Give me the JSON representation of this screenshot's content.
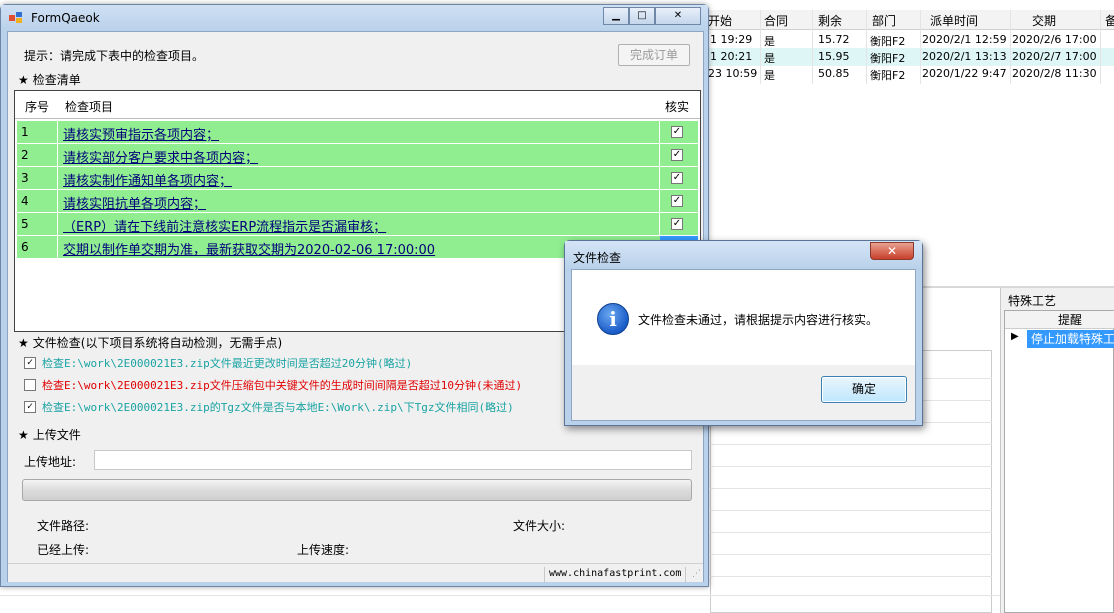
{
  "background": {
    "headers": [
      "开始",
      "合同",
      "剩余",
      "部门",
      "派单时间",
      "交期",
      "备"
    ],
    "rows": [
      {
        "start": "1 19:29",
        "contract": "是",
        "remaining": "15.72",
        "dept": "衡阳F2",
        "dispatch": "2020/2/1 12:59",
        "due": "2020/2/6 17:00"
      },
      {
        "start": "1 20:21",
        "contract": "是",
        "remaining": "15.95",
        "dept": "衡阳F2",
        "dispatch": "2020/2/1 13:13",
        "due": "2020/2/7 17:00"
      },
      {
        "start": "23 10:59",
        "contract": "是",
        "remaining": "50.85",
        "dept": "衡阳F2",
        "dispatch": "2020/1/22 9:47",
        "due": "2020/2/8 11:30"
      }
    ],
    "special_process": {
      "title": "特殊工艺",
      "column": "提醒",
      "cell": "停止加载特殊工"
    }
  },
  "form": {
    "title": "FormQaeok",
    "buttons": {
      "minimize": "▁",
      "maximize": "□",
      "close": "✕"
    },
    "hint": "提示：请完成下表中的检查项目。",
    "finish_button": "完成订单",
    "checklist_section": "检查清单",
    "checklist_headers": {
      "index": "序号",
      "item": "检查项目",
      "verify": "核实"
    },
    "checklist": [
      {
        "index": "1",
        "item": "请核实预审指示各项内容；",
        "checked": true
      },
      {
        "index": "2",
        "item": "请核实部分客户要求中各项内容；",
        "checked": true
      },
      {
        "index": "3",
        "item": "请核实制作通知单各项内容；",
        "checked": true
      },
      {
        "index": "4",
        "item": "请核实阻抗单各项内容；",
        "checked": true
      },
      {
        "index": "5",
        "item": "（ERP）请在下线前注意核实ERP流程指示是否漏审核；",
        "checked": true
      },
      {
        "index": "6",
        "item": "交期以制作单交期为准，最新获取交期为2020-02-06 17:00:00",
        "checked": false
      }
    ],
    "file_check_section": "文件检查(以下项目系统将自动检测，无需手点)",
    "file_checks": [
      {
        "text": "检查E:\\work\\2E000021E3.zip文件最近更改时间是否超过20分钟(略过)",
        "checked": true,
        "color": "#1aa3a3"
      },
      {
        "text": "检查E:\\work\\2E000021E3.zip文件压缩包中关键文件的生成时间间隔是否超过10分钟(未通过)",
        "checked": false,
        "color": "#e00000"
      },
      {
        "text": "检查E:\\work\\2E000021E3.zip的Tgz文件是否与本地E:\\Work\\.zip\\下Tgz文件相同(略过)",
        "checked": true,
        "color": "#1aa3a3"
      }
    ],
    "upload_section": "上传文件",
    "upload_address_label": "上传地址:",
    "upload_address_value": "",
    "file_path_label": "文件路径:",
    "file_size_label": "文件大小:",
    "uploaded_label": "已经上传:",
    "upload_speed_label": "上传速度:",
    "status_text": "www.chinafastprint.com"
  },
  "dialog": {
    "title": "文件检查",
    "close": "✕",
    "message": "文件检查未通过，请根据提示内容进行核实。",
    "icon": "info-icon",
    "ok_button": "确定"
  }
}
